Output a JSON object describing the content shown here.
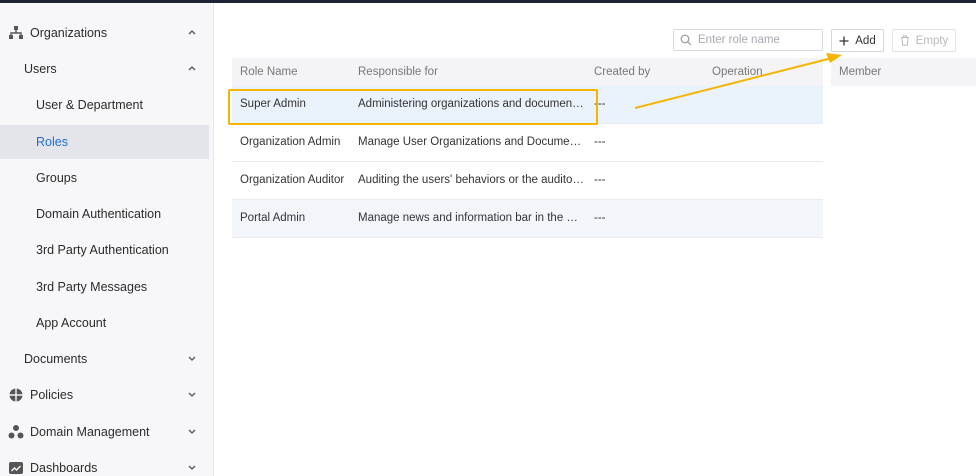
{
  "sidebar": {
    "items": [
      {
        "label": "Organizations",
        "level": 0,
        "icon": "org-icon",
        "expanded": true
      },
      {
        "label": "Users",
        "level": 1,
        "expanded": true
      },
      {
        "label": "User & Department",
        "level": 2
      },
      {
        "label": "Roles",
        "level": 2,
        "active": true
      },
      {
        "label": "Groups",
        "level": 2
      },
      {
        "label": "Domain Authentication",
        "level": 2
      },
      {
        "label": "3rd Party Authentication",
        "level": 2
      },
      {
        "label": "3rd Party Messages",
        "level": 2
      },
      {
        "label": "App Account",
        "level": 2
      },
      {
        "label": "Documents",
        "level": 1,
        "expanded": false
      },
      {
        "label": "Policies",
        "level": 0,
        "icon": "shield-icon",
        "expanded": false
      },
      {
        "label": "Domain Management",
        "level": 0,
        "icon": "domain-icon",
        "expanded": false
      },
      {
        "label": "Dashboards",
        "level": 0,
        "icon": "dashboard-icon",
        "expanded": false
      }
    ]
  },
  "toolbar": {
    "search_placeholder": "Enter role name",
    "add_label": "Add",
    "empty_label": "Empty"
  },
  "table": {
    "columns": [
      "Role Name",
      "Responsible for",
      "Created by",
      "Operation"
    ],
    "rows": [
      {
        "name": "Super Admin",
        "responsible": "Administering organizations and documents, ...",
        "created_by": "---"
      },
      {
        "name": "Organization Admin",
        "responsible": "Manage User Organizations and Document Or...",
        "created_by": "---"
      },
      {
        "name": "Organization Auditor",
        "responsible": "Auditing the users'   behaviors or the auditors...",
        "created_by": "---"
      },
      {
        "name": "Portal Admin",
        "responsible": "Manage news and information bar in the portal",
        "created_by": "---"
      }
    ]
  },
  "member_panel": {
    "header": "Member"
  },
  "colors": {
    "accent": "#1f6fd1",
    "annotation": "#f5b400"
  }
}
